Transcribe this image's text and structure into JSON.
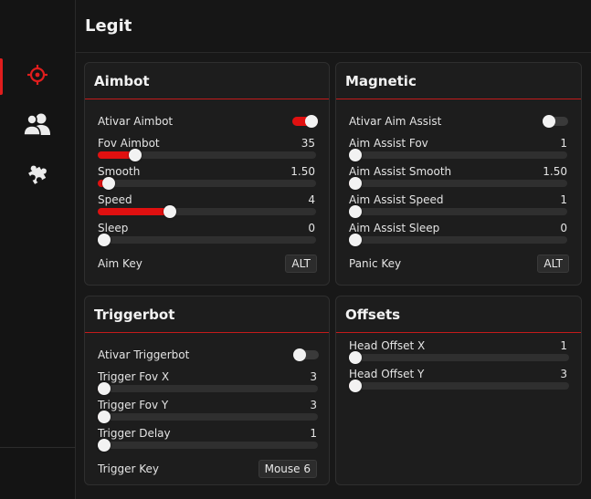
{
  "page": {
    "title": "Legit"
  },
  "colors": {
    "accent": "#e01010",
    "background": "#141414",
    "panel": "#1d1d1d"
  },
  "sidebar": {
    "items": [
      {
        "icon": "crosshair-icon",
        "active": true
      },
      {
        "icon": "users-icon",
        "active": false
      },
      {
        "icon": "puzzle-icon",
        "active": false
      }
    ]
  },
  "aimbot": {
    "title": "Aimbot",
    "toggle": {
      "label": "Ativar Aimbot",
      "on": true
    },
    "sliders": [
      {
        "label": "Fov Aimbot",
        "value": "35",
        "fraction": 0.17
      },
      {
        "label": "Smooth",
        "value": "1.50",
        "fraction": 0.05
      },
      {
        "label": "Speed",
        "value": "4",
        "fraction": 0.33
      },
      {
        "label": "Sleep",
        "value": "0",
        "fraction": 0.0
      }
    ],
    "key": {
      "label": "Aim Key",
      "value": "ALT"
    }
  },
  "magnetic": {
    "title": "Magnetic",
    "toggle": {
      "label": "Ativar Aim Assist",
      "on": false
    },
    "sliders": [
      {
        "label": "Aim Assist Fov",
        "value": "1",
        "fraction": 0.0
      },
      {
        "label": "Aim Assist Smooth",
        "value": "1.50",
        "fraction": 0.02
      },
      {
        "label": "Aim Assist Speed",
        "value": "1",
        "fraction": 0.0
      },
      {
        "label": "Aim Assist Sleep",
        "value": "0",
        "fraction": 0.0
      }
    ],
    "key": {
      "label": "Panic Key",
      "value": "ALT"
    }
  },
  "triggerbot": {
    "title": "Triggerbot",
    "toggle": {
      "label": "Ativar Triggerbot",
      "on": false
    },
    "sliders": [
      {
        "label": "Trigger Fov X",
        "value": "3",
        "fraction": 0.02
      },
      {
        "label": "Trigger Fov Y",
        "value": "3",
        "fraction": 0.02
      },
      {
        "label": "Trigger Delay",
        "value": "1",
        "fraction": 0.0
      }
    ],
    "key": {
      "label": "Trigger Key",
      "value": "Mouse 6"
    }
  },
  "offsets": {
    "title": "Offsets",
    "sliders": [
      {
        "label": "Head Offset X",
        "value": "1",
        "fraction": 0.0
      },
      {
        "label": "Head Offset Y",
        "value": "3",
        "fraction": 0.03
      }
    ]
  }
}
